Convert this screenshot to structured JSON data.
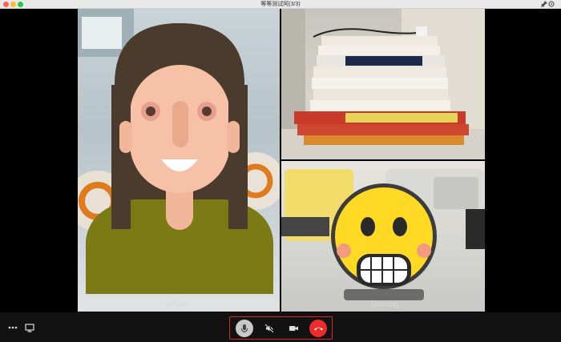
{
  "window": {
    "title": "等等测试阿(3/3)"
  },
  "participants": [
    {
      "name": "Allison"
    },
    {
      "name": ""
    },
    {
      "name": "Daming"
    }
  ],
  "colors": {
    "hangup": "#ee2b2b",
    "highlight_border": "#d8262e",
    "mic_active": "#c9c9c9"
  },
  "controls": {
    "more_icon": "ellipsis-icon",
    "share_icon": "screen-share-icon",
    "mic_icon": "microphone-icon",
    "speaker_icon": "speaker-muted-icon",
    "camera_icon": "video-camera-icon",
    "hangup_icon": "phone-hangup-icon"
  }
}
